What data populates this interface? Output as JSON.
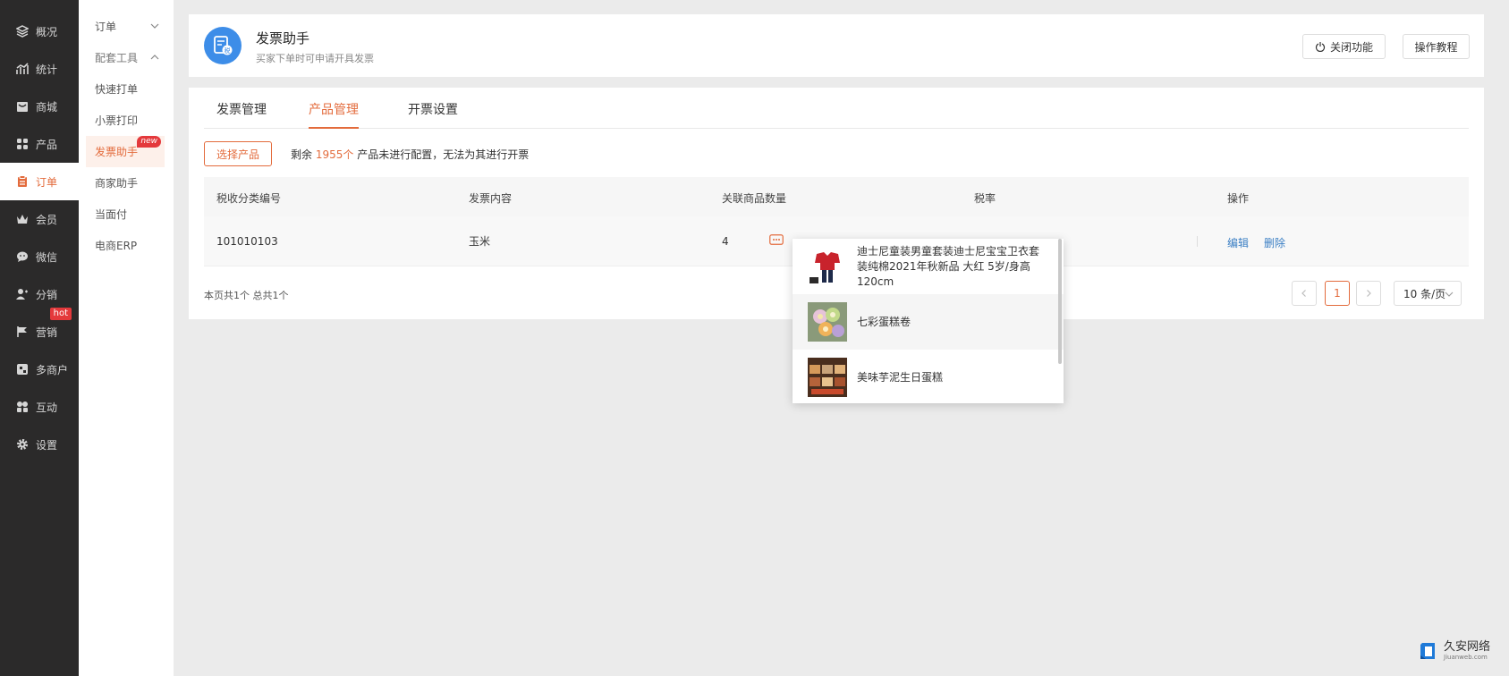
{
  "sidebar": {
    "items": [
      {
        "label": "概况",
        "icon": "layers-icon"
      },
      {
        "label": "统计",
        "icon": "stats-icon"
      },
      {
        "label": "商城",
        "icon": "store-icon"
      },
      {
        "label": "产品",
        "icon": "grid-icon"
      },
      {
        "label": "订单",
        "icon": "order-icon",
        "active": true
      },
      {
        "label": "会员",
        "icon": "crown-icon"
      },
      {
        "label": "微信",
        "icon": "wechat-icon"
      },
      {
        "label": "分销",
        "icon": "distribution-icon"
      },
      {
        "label": "营销",
        "icon": "flag-icon",
        "badge": "hot"
      },
      {
        "label": "多商户",
        "icon": "merchant-icon"
      },
      {
        "label": "互动",
        "icon": "interact-icon"
      },
      {
        "label": "设置",
        "icon": "gear-icon"
      }
    ]
  },
  "submenu": {
    "items": [
      {
        "label": "订单",
        "type": "group"
      },
      {
        "label": "配套工具",
        "type": "group"
      },
      {
        "label": "快速打单"
      },
      {
        "label": "小票打印"
      },
      {
        "label": "发票助手",
        "active": true,
        "badge": "new"
      },
      {
        "label": "商家助手"
      },
      {
        "label": "当面付"
      },
      {
        "label": "电商ERP"
      }
    ]
  },
  "header": {
    "title": "发票助手",
    "subtitle": "买家下单时可申请开具发票",
    "close_label": "关闭功能",
    "guide_label": "操作教程"
  },
  "tabs": [
    "发票管理",
    "产品管理",
    "开票设置"
  ],
  "active_tab": "产品管理",
  "toolbar": {
    "select_label": "选择产品",
    "remain_prefix": "剩余",
    "remain_count": "1955个",
    "remain_suffix": "产品未进行配置，无法为其进行开票"
  },
  "table": {
    "columns": [
      "税收分类编号",
      "发票内容",
      "关联商品数量",
      "税率",
      "操作"
    ],
    "rows": [
      {
        "code": "101010103",
        "content": "玉米",
        "count": "4",
        "tax": "",
        "edit": "编辑",
        "delete": "删除"
      }
    ]
  },
  "popover": {
    "items": [
      {
        "title": "迪士尼童装男童套装迪士尼宝宝卫衣套装纯棉2021年秋新品 大红 5岁/身高120cm",
        "thumb": "clothes-thumb"
      },
      {
        "title": "七彩蛋糕卷",
        "thumb": "cake-roll-thumb"
      },
      {
        "title": "美味芋泥生日蛋糕",
        "thumb": "taro-cake-thumb"
      }
    ]
  },
  "pagination": {
    "info": "本页共1个 总共1个",
    "current": "1",
    "page_size": "10 条/页"
  },
  "watermark": {
    "main": "久安网络",
    "sub": "Jiuanweb.com"
  },
  "colors": {
    "accent": "#e36b3c",
    "link": "#3b7fc4",
    "sidebar_bg": "#2b2a2a",
    "logo_blue": "#3d8de8"
  }
}
